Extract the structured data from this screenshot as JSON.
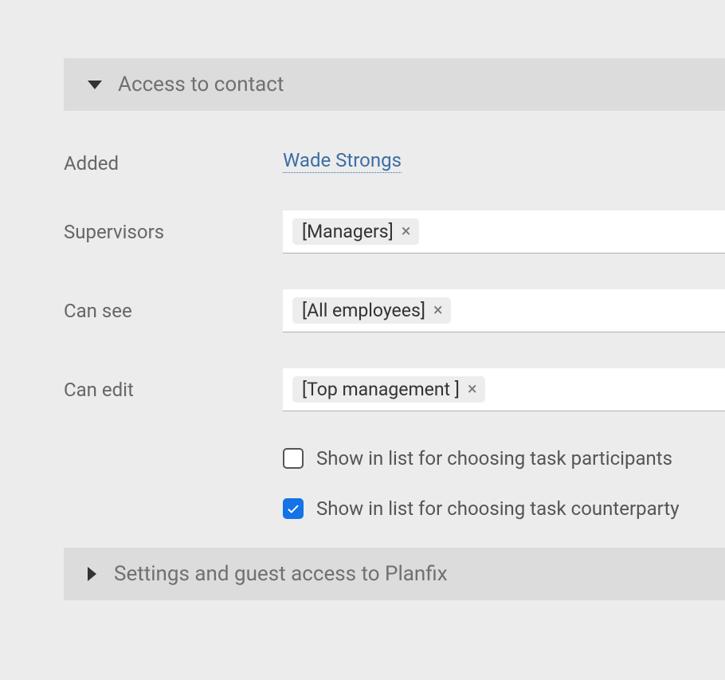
{
  "sections": {
    "access": {
      "title": "Access to contact",
      "expanded": true
    },
    "settings": {
      "title": "Settings and guest access to Planfix",
      "expanded": false
    }
  },
  "fields": {
    "added": {
      "label": "Added",
      "link_text": "Wade Strongs"
    },
    "supervisors": {
      "label": "Supervisors",
      "tags": [
        "[Managers]"
      ]
    },
    "can_see": {
      "label": "Can see",
      "tags": [
        "[All employees]"
      ]
    },
    "can_edit": {
      "label": "Can edit",
      "tags": [
        "[Top management ]"
      ]
    }
  },
  "checkboxes": {
    "show_participants": {
      "label": "Show in list for choosing task participants",
      "checked": false
    },
    "show_counterparty": {
      "label": "Show in list for choosing task counterparty",
      "checked": true
    }
  }
}
